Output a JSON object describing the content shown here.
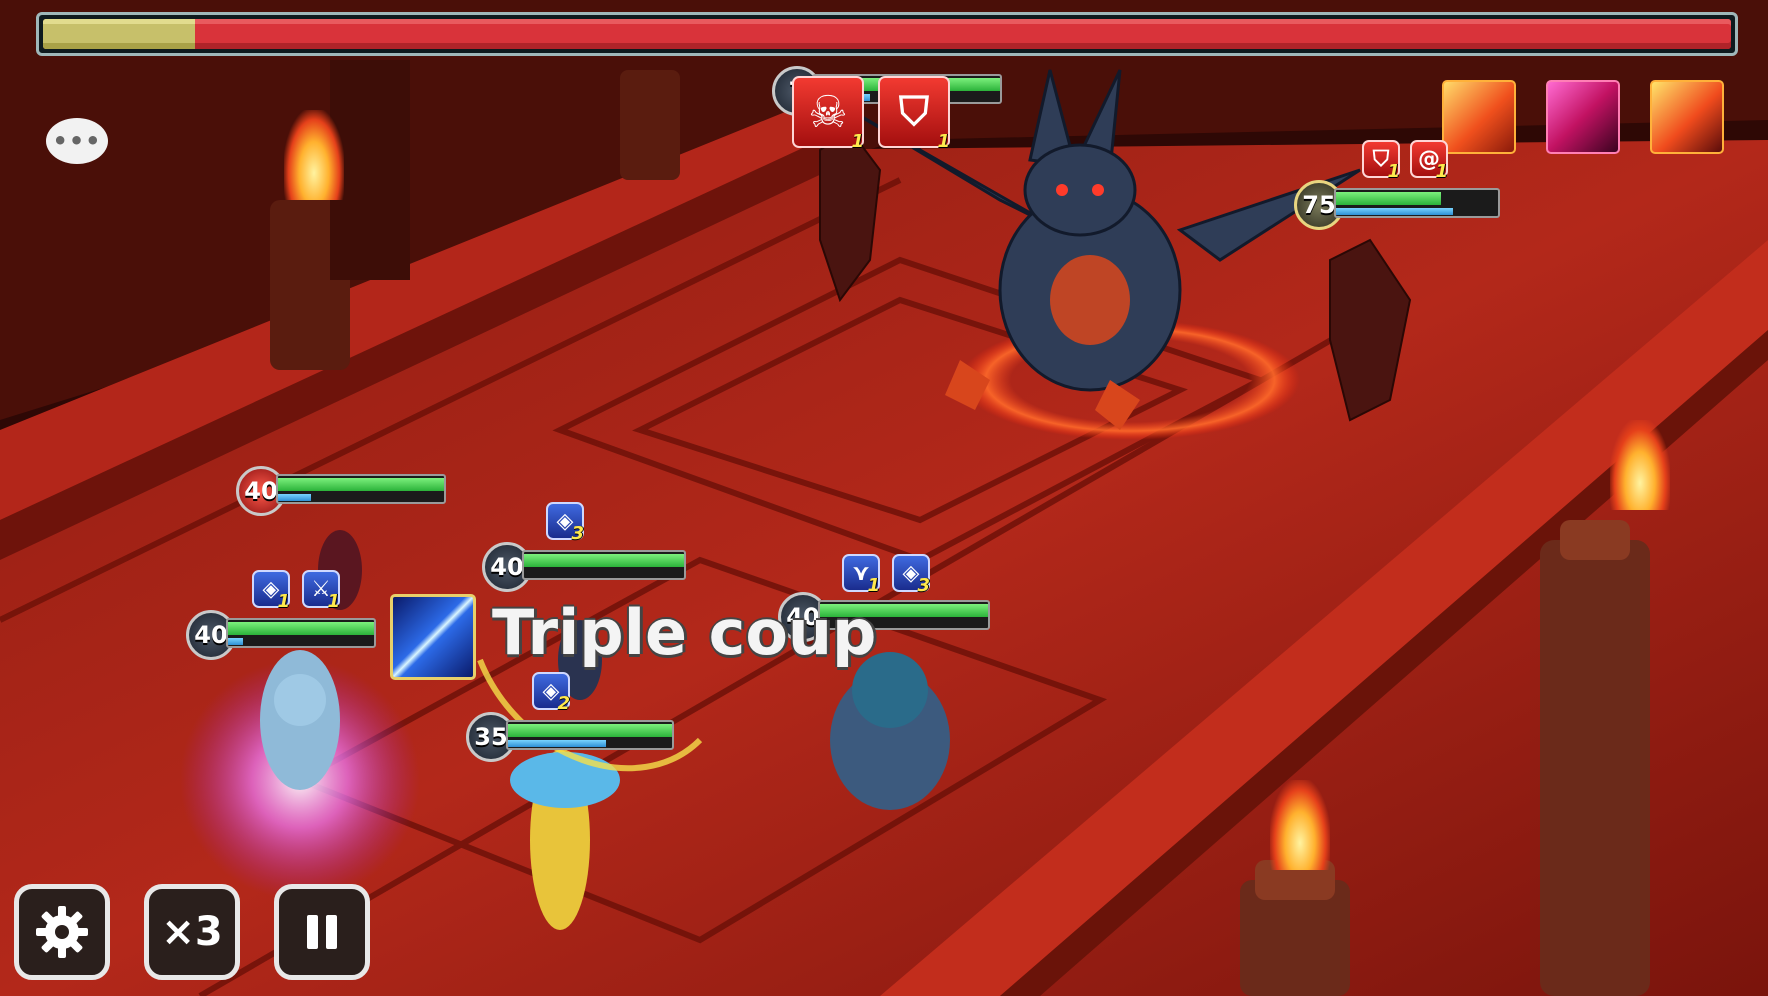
{
  "boss": {
    "hp_fraction": 0.09
  },
  "chat_button": {
    "icon": "chat-bubble-icon",
    "label": "•••"
  },
  "enemy_skills": [
    {
      "name": "fire-slash-skill-icon"
    },
    {
      "name": "magenta-strike-skill-icon"
    },
    {
      "name": "flame-burst-skill-icon"
    }
  ],
  "enemies": [
    {
      "id": "minion",
      "level": "7",
      "debuffs": [
        {
          "icon": "skull-icon",
          "count": "1"
        },
        {
          "icon": "broken-shield-icon",
          "count": "1"
        }
      ]
    },
    {
      "id": "dragon",
      "level": "75",
      "debuffs": [
        {
          "icon": "broken-shield-icon",
          "count": "1"
        },
        {
          "icon": "spiral-icon",
          "count": "1"
        }
      ],
      "hp_fraction": 0.65,
      "attack_bar": 0.72
    }
  ],
  "allies": [
    {
      "id": "ally-1",
      "level": "40",
      "hp_fraction": 1.0,
      "attack_bar": 0.2,
      "buffs": []
    },
    {
      "id": "ally-2",
      "level": "40",
      "hp_fraction": 1.0,
      "attack_bar": 0.1,
      "buffs": [
        {
          "icon": "defense-up-icon",
          "count": "1"
        },
        {
          "icon": "immunity-icon",
          "count": "1"
        }
      ]
    },
    {
      "id": "ally-3",
      "level": "40",
      "hp_fraction": 1.0,
      "attack_bar": 0.0,
      "buffs": [
        {
          "icon": "defense-up-icon",
          "count": "3"
        }
      ]
    },
    {
      "id": "ally-4",
      "level": "40",
      "hp_fraction": 1.0,
      "attack_bar": 0.0,
      "buffs": [
        {
          "icon": "wing-icon",
          "count": "1"
        },
        {
          "icon": "defense-up-icon",
          "count": "3"
        }
      ]
    },
    {
      "id": "ally-5",
      "level": "35",
      "hp_fraction": 1.0,
      "attack_bar": 0.6,
      "buffs": [
        {
          "icon": "defense-up-icon",
          "count": "2"
        }
      ]
    }
  ],
  "skill_popup": {
    "icon": "lightning-slash-icon",
    "name": "Triple coup"
  },
  "controls": {
    "settings": {
      "icon": "gear-icon"
    },
    "speed": {
      "label": "×3"
    },
    "pause": {
      "icon": "pause-icon"
    }
  },
  "colors": {
    "hp": "#2bb33a",
    "atb": "#2e8fd5",
    "boss_hp_fill": "#c7c06a",
    "boss_hp_empty": "#d9333a"
  }
}
